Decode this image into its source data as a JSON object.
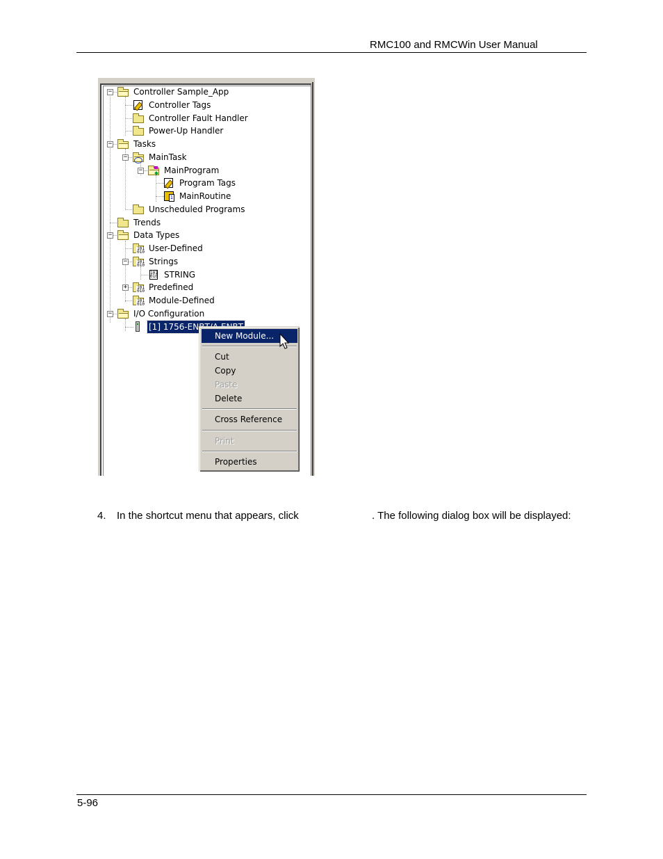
{
  "header": {
    "title": "RMC100 and RMCWin User Manual"
  },
  "footer": {
    "page_number": "5-96"
  },
  "tree": {
    "nodes": [
      {
        "label": "Controller Sample_App",
        "icon": "folder-open-icon",
        "expander": "minus"
      },
      {
        "label": "Controller Tags",
        "icon": "tags-icon"
      },
      {
        "label": "Controller Fault Handler",
        "icon": "folder-icon"
      },
      {
        "label": "Power-Up Handler",
        "icon": "folder-icon"
      },
      {
        "label": "Tasks",
        "icon": "folder-open-icon",
        "expander": "minus"
      },
      {
        "label": "MainTask",
        "icon": "task-icon",
        "expander": "minus"
      },
      {
        "label": "MainProgram",
        "icon": "program-icon",
        "expander": "minus"
      },
      {
        "label": "Program Tags",
        "icon": "tags-icon"
      },
      {
        "label": "MainRoutine",
        "icon": "routine-icon"
      },
      {
        "label": "Unscheduled Programs",
        "icon": "folder-icon"
      },
      {
        "label": "Trends",
        "icon": "folder-icon"
      },
      {
        "label": "Data Types",
        "icon": "folder-open-icon",
        "expander": "minus"
      },
      {
        "label": "User-Defined",
        "icon": "datatype-folder-icon"
      },
      {
        "label": "Strings",
        "icon": "datatype-folder-icon",
        "expander": "minus"
      },
      {
        "label": "STRING",
        "icon": "datatype-icon"
      },
      {
        "label": "Predefined",
        "icon": "datatype-folder-icon",
        "expander": "plus"
      },
      {
        "label": "Module-Defined",
        "icon": "datatype-folder-icon"
      },
      {
        "label": "I/O Configuration",
        "icon": "folder-open-icon",
        "expander": "minus"
      },
      {
        "label": "[1] 1756-ENBT/A ENBT",
        "icon": "module-icon",
        "selected": true
      }
    ]
  },
  "context_menu": {
    "items": [
      {
        "label": "New Module...",
        "highlighted": true
      },
      {
        "label": "Cut"
      },
      {
        "label": "Copy"
      },
      {
        "label": "Paste",
        "disabled": true
      },
      {
        "label": "Delete"
      },
      {
        "label": "Cross Reference"
      },
      {
        "label": "Print",
        "disabled": true
      },
      {
        "label": "Properties"
      }
    ]
  },
  "body": {
    "step_number": "4.",
    "step_text_before": "In the shortcut menu that appears, click",
    "step_text_after": ". The following dialog box will be displayed:"
  },
  "colors": {
    "selection": "#0a246a",
    "menu_bg": "#d4d0c8",
    "folder": "#f0e68c"
  }
}
